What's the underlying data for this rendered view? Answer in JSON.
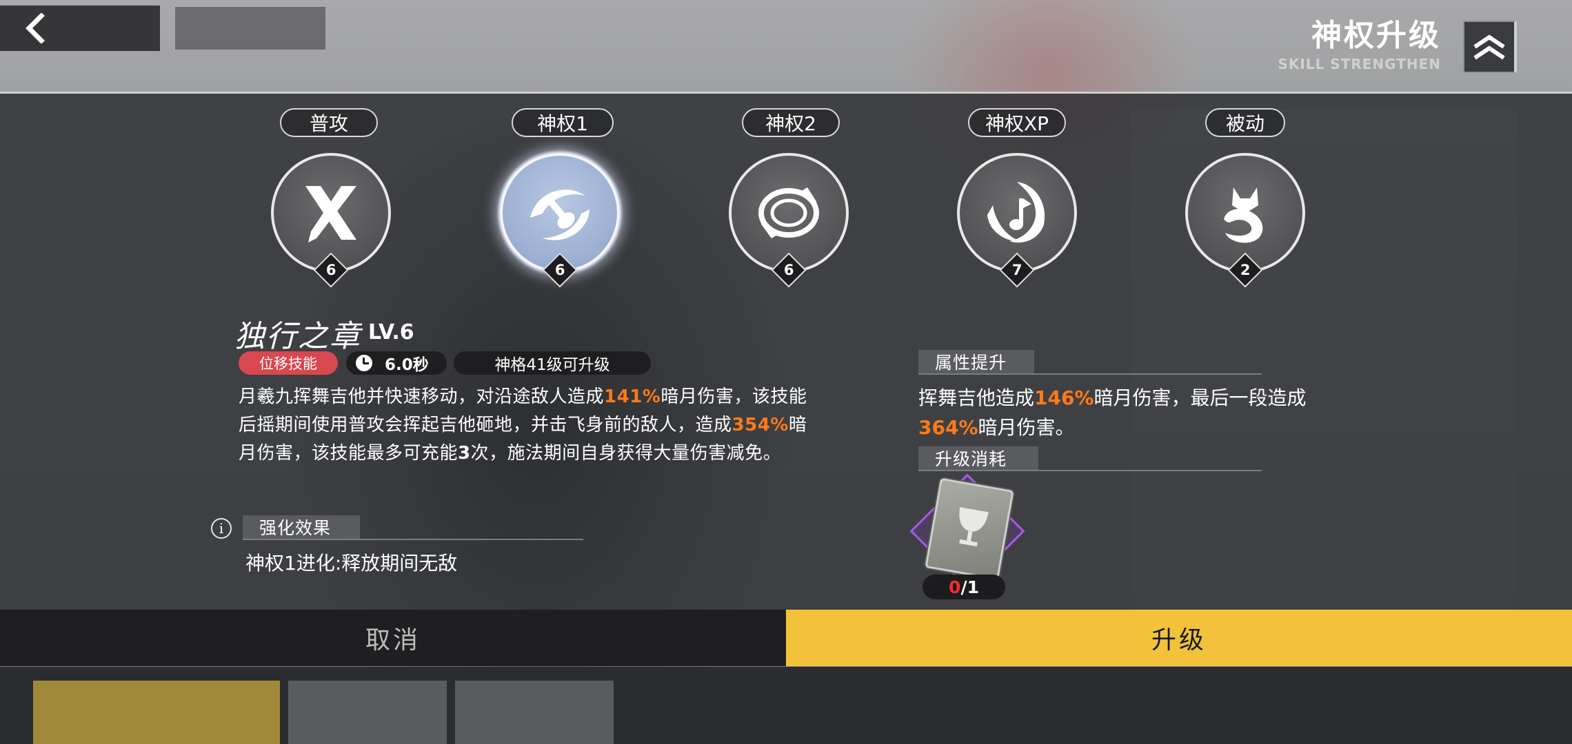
{
  "header": {
    "title": "神权升级",
    "subtitle": "SKILL STRENGTHEN"
  },
  "tabs": [
    {
      "label": "普攻",
      "level": "6",
      "icon": "crossed-blades-icon",
      "active": false
    },
    {
      "label": "神权1",
      "level": "6",
      "icon": "guitar-swirl-icon",
      "active": true
    },
    {
      "label": "神权2",
      "level": "6",
      "icon": "ring-slash-icon",
      "active": false
    },
    {
      "label": "神权XP",
      "level": "7",
      "icon": "music-note-flame-icon",
      "active": false
    },
    {
      "label": "被动",
      "level": "2",
      "icon": "fox-icon",
      "active": false
    }
  ],
  "skill": {
    "name": "独行之章",
    "level": "LV.6",
    "type_tag": "位移技能",
    "cooldown": "6.0秒",
    "requirement": "神格41级可升级",
    "description": {
      "p1": "月羲九挥舞吉他并快速移动，对沿途敌人造成",
      "v1": "141%",
      "p2": "暗月伤害，该技能后摇期间使用普攻会挥起吉他砸地，并击飞身前的敌人，造成",
      "v2": "354%",
      "p3": "暗月伤害，该技能最多可充能",
      "v3": "3",
      "p4": "次，施法期间自身获得大量伤害减免。"
    },
    "enhance_header": "强化效果",
    "enhance_text": "神权1进化:释放期间无敌"
  },
  "attribute": {
    "header": "属性提升",
    "p1": "挥舞吉他造成",
    "v1": "146%",
    "p2": "暗月伤害，最后一段造成",
    "v2": "364%",
    "p3": "暗月伤害。"
  },
  "cost": {
    "header": "升级消耗",
    "item_icon": "chalice-book-icon",
    "owned": "0",
    "required": "/1"
  },
  "buttons": {
    "cancel": "取消",
    "upgrade": "升级"
  },
  "colors": {
    "accent_yellow": "#f2c33a",
    "highlight_orange": "#ff7a1a",
    "tag_red": "#d9474f",
    "rarity_purple": "#a25ce8"
  }
}
